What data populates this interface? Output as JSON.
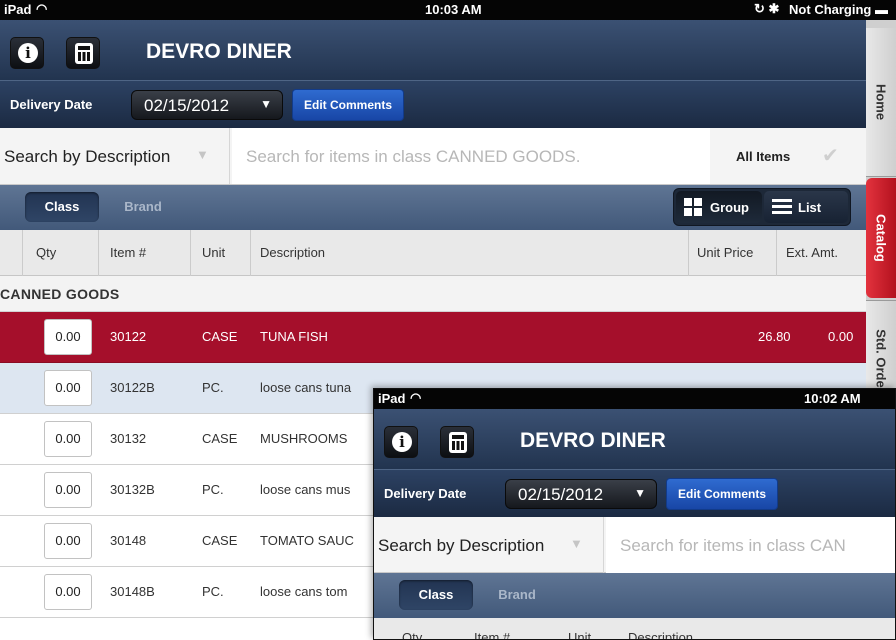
{
  "status": {
    "carrier": "iPad",
    "time": "10:03 AM",
    "battery": "Not Charging"
  },
  "header": {
    "title": "DEVRO DINER"
  },
  "delivery": {
    "label": "Delivery Date",
    "date": "02/15/2012",
    "edit_label": "Edit Comments"
  },
  "search": {
    "by_label": "Search by Description",
    "placeholder": "Search for items in class CANNED GOODS.",
    "all_items": "All Items"
  },
  "segments": {
    "class": "Class",
    "brand": "Brand",
    "group": "Group",
    "list": "List"
  },
  "columns": {
    "qty": "Qty",
    "item": "Item #",
    "unit": "Unit",
    "description": "Description",
    "unit_price": "Unit Price",
    "ext_amt": "Ext. Amt."
  },
  "group_name": "CANNED GOODS",
  "rows": [
    {
      "qty": "0.00",
      "item": "30122",
      "unit": "CASE",
      "description": "TUNA FISH",
      "price": "26.80",
      "ext": "0.00"
    },
    {
      "qty": "0.00",
      "item": "30122B",
      "unit": "PC.",
      "description": "loose cans tuna"
    },
    {
      "qty": "0.00",
      "item": "30132",
      "unit": "CASE",
      "description": "MUSHROOMS"
    },
    {
      "qty": "0.00",
      "item": "30132B",
      "unit": "PC.",
      "description": "loose cans mus"
    },
    {
      "qty": "0.00",
      "item": "30148",
      "unit": "CASE",
      "description": "TOMATO SAUC"
    },
    {
      "qty": "0.00",
      "item": "30148B",
      "unit": "PC.",
      "description": "loose cans tom"
    }
  ],
  "sidetabs": {
    "home": "Home",
    "catalog": "Catalog",
    "std_order": "Std. Order"
  },
  "overlay": {
    "carrier": "iPad",
    "time": "10:02 AM",
    "title": "DEVRO DINER",
    "delivery_label": "Delivery Date",
    "date": "02/15/2012",
    "edit_label": "Edit Comments",
    "search_by": "Search by Description",
    "placeholder": "Search for items in class CAN",
    "class": "Class",
    "brand": "Brand",
    "col_qty": "Qty",
    "col_item": "Item #",
    "col_unit": "Unit",
    "col_desc": "Description"
  },
  "colors": {
    "header_navy": "#2d4263",
    "selected_row": "#a50f2b",
    "catalog_tab": "#d22230",
    "edit_button": "#2461c6"
  }
}
